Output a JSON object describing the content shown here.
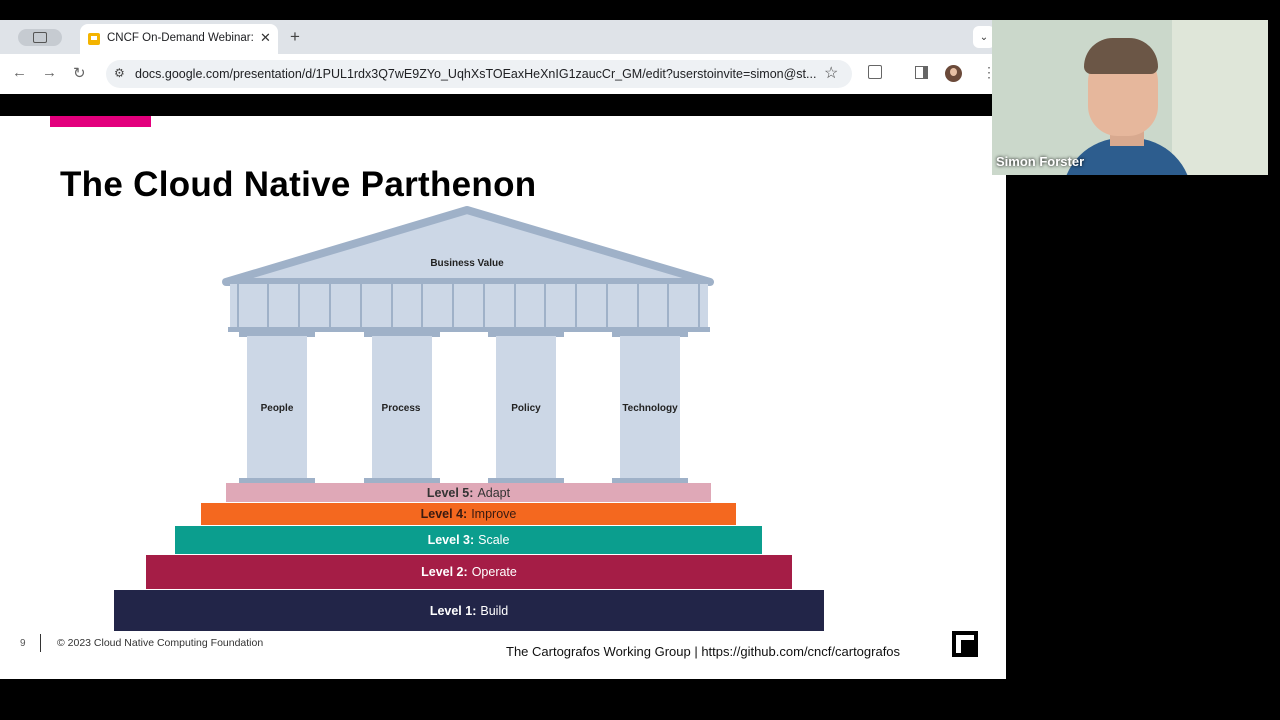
{
  "browser": {
    "tab_title": "CNCF On-Demand Webinar: F",
    "new_tab_label": "+",
    "url": "docs.google.com/presentation/d/1PUL1rdx3Q7wE9ZYo_UqhXsTOEaxHeXnIG1zaucCr_GM/edit?userstoinvite=simon@st..."
  },
  "slide": {
    "title": "The Cloud Native Parthenon",
    "roof_label": "Business Value",
    "pillars": [
      "People",
      "Process",
      "Policy",
      "Technology"
    ],
    "levels": [
      {
        "strong": "Level 5:",
        "text": "Adapt",
        "color": "#dfa8b7",
        "text_color": "#333333"
      },
      {
        "strong": "Level 4:",
        "text": "Improve",
        "color": "#f4681f",
        "text_color": "#3a1a10"
      },
      {
        "strong": "Level 3:",
        "text": "Scale",
        "color": "#0b9e8e",
        "text_color": "#ffffff"
      },
      {
        "strong": "Level 2:",
        "text": "Operate",
        "color": "#a51d46",
        "text_color": "#ffffff"
      },
      {
        "strong": "Level 1:",
        "text": "Build",
        "color": "#222548",
        "text_color": "#ffffff"
      }
    ],
    "slide_number": "9",
    "copyright": "© 2023 Cloud Native Computing Foundation",
    "footer_right": "The Cartografos Working Group  |  https://github.com/cncf/cartografos",
    "accent_color": "#e3007d"
  },
  "webcam": {
    "participant_name": "Simon Forster"
  }
}
